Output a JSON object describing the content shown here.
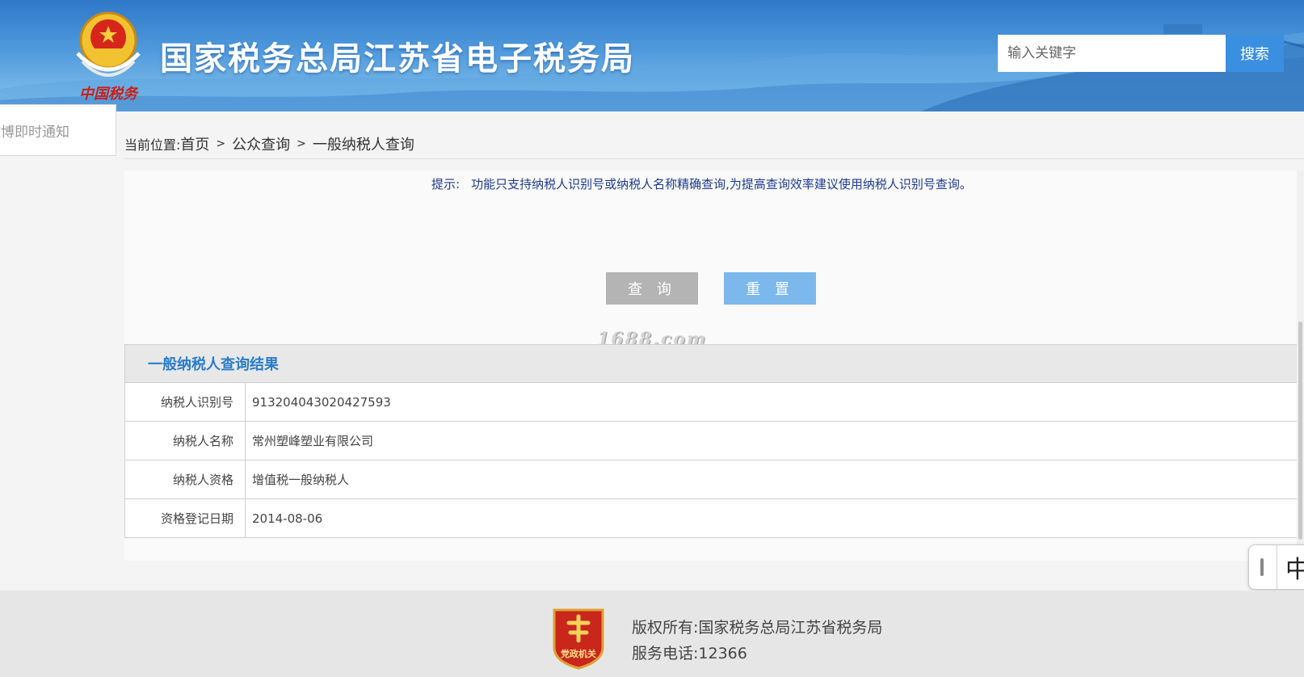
{
  "header": {
    "site_title": "国家税务总局江苏省电子税务局",
    "emblem_caption": "中国税务",
    "search": {
      "placeholder": "输入关键字",
      "button_label": "搜索"
    }
  },
  "side_tab": {
    "label": "微博即时通知"
  },
  "breadcrumb": {
    "label": "当前位置:",
    "items": [
      "首页",
      "公众查询",
      "一般纳税人查询"
    ],
    "separator": ">"
  },
  "query_panel": {
    "tip_label": "提示:",
    "tip_text": "功能只支持纳税人识别号或纳税人名称精确查询,为提高查询效率建议使用纳税人识别号查询。",
    "query_button": "查 询",
    "reset_button": "重 置",
    "watermark": "1688.com"
  },
  "results": {
    "title": "一般纳税人查询结果",
    "rows": [
      {
        "key": "纳税人识别号",
        "value": "913204043020427593"
      },
      {
        "key": "纳税人名称",
        "value": "常州塑峰塑业有限公司"
      },
      {
        "key": "纳税人资格",
        "value": "增值税一般纳税人"
      },
      {
        "key": "资格登记日期",
        "value": "2014-08-06"
      }
    ]
  },
  "ime_indicator": {
    "mode": "中"
  },
  "footer": {
    "badge_text": "党政机关",
    "copyright": "版权所有:国家税务总局江苏省税务局",
    "hotline": "服务电话:12366"
  },
  "colors": {
    "header_blue": "#2f78c8",
    "search_button": "#3b8fe0",
    "tip_text": "#1d3a8f",
    "results_title": "#2a7dc9",
    "query_button": "#b4b4b4",
    "reset_button": "#7cb8ec",
    "badge_red": "#c9261c"
  }
}
